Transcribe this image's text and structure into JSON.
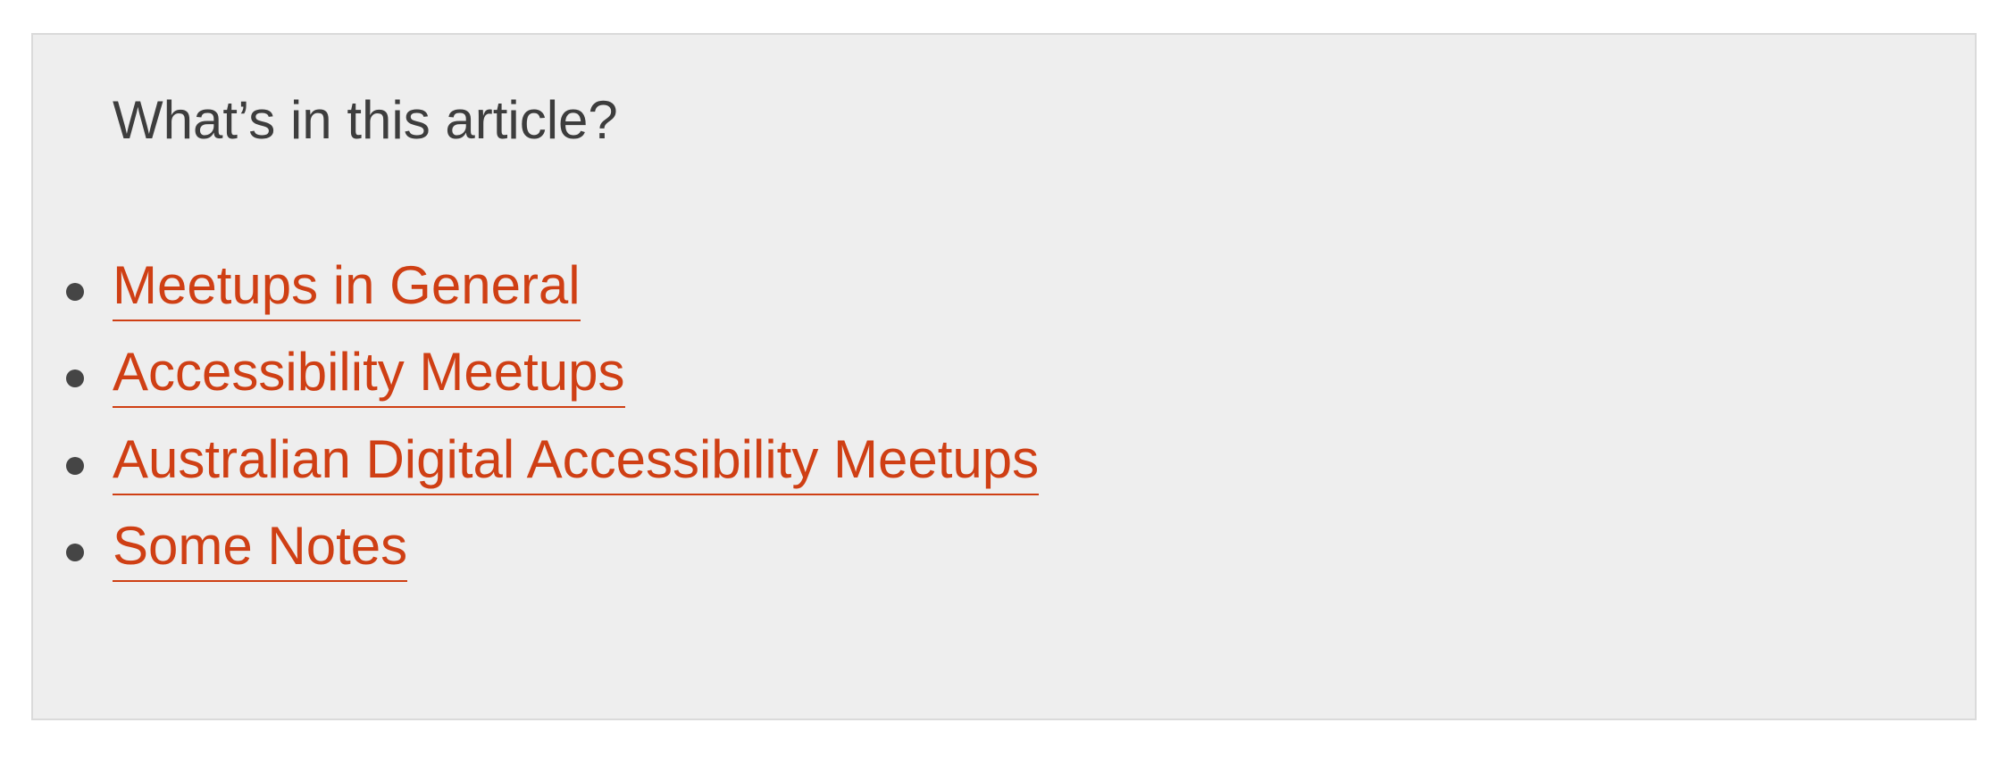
{
  "toc": {
    "title": "What’s in this article?",
    "items": [
      {
        "label": "Meetups in General"
      },
      {
        "label": "Accessibility Meetups"
      },
      {
        "label": "Australian Digital Accessibility Meetups"
      },
      {
        "label": "Some Notes"
      }
    ]
  },
  "colors": {
    "panel_background": "#eeeeee",
    "panel_border": "#dadada",
    "heading_text": "#3d3d3d",
    "link": "#cf3f14",
    "bullet": "#454545"
  }
}
